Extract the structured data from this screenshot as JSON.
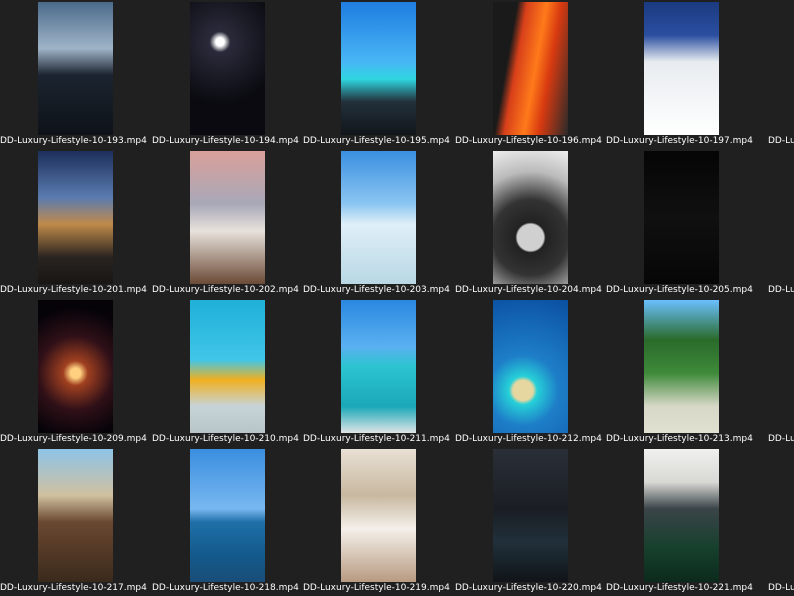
{
  "files": [
    {
      "label": "DD-Luxury-Lifestyle-10-193.mp4",
      "thumb": "t193"
    },
    {
      "label": "DD-Luxury-Lifestyle-10-194.mp4",
      "thumb": "t194"
    },
    {
      "label": "DD-Luxury-Lifestyle-10-195.mp4",
      "thumb": "t195"
    },
    {
      "label": "DD-Luxury-Lifestyle-10-196.mp4",
      "thumb": "t196"
    },
    {
      "label": "DD-Luxury-Lifestyle-10-197.mp4",
      "thumb": "t197"
    },
    {
      "label": "DD-Luxury-Lifestyle-10-201.mp4",
      "thumb": "t201"
    },
    {
      "label": "DD-Luxury-Lifestyle-10-202.mp4",
      "thumb": "t202"
    },
    {
      "label": "DD-Luxury-Lifestyle-10-203.mp4",
      "thumb": "t203"
    },
    {
      "label": "DD-Luxury-Lifestyle-10-204.mp4",
      "thumb": "t204"
    },
    {
      "label": "DD-Luxury-Lifestyle-10-205.mp4",
      "thumb": "t205"
    },
    {
      "label": "DD-Luxury-Lifestyle-10-209.mp4",
      "thumb": "t209"
    },
    {
      "label": "DD-Luxury-Lifestyle-10-210.mp4",
      "thumb": "t210"
    },
    {
      "label": "DD-Luxury-Lifestyle-10-211.mp4",
      "thumb": "t211"
    },
    {
      "label": "DD-Luxury-Lifestyle-10-212.mp4",
      "thumb": "t212"
    },
    {
      "label": "DD-Luxury-Lifestyle-10-213.mp4",
      "thumb": "t213"
    },
    {
      "label": "DD-Luxury-Lifestyle-10-217.mp4",
      "thumb": "t217"
    },
    {
      "label": "DD-Luxury-Lifestyle-10-218.mp4",
      "thumb": "t218"
    },
    {
      "label": "DD-Luxury-Lifestyle-10-219.mp4",
      "thumb": "t219"
    },
    {
      "label": "DD-Luxury-Lifestyle-10-220.mp4",
      "thumb": "t220"
    },
    {
      "label": "DD-Luxury-Lifestyle-10-221.mp4",
      "thumb": "t221"
    }
  ],
  "partial_column_labels": [
    "DD-Luxury-",
    "DD-Luxury-",
    "DD-Luxury-",
    "DD-Luxury-"
  ]
}
